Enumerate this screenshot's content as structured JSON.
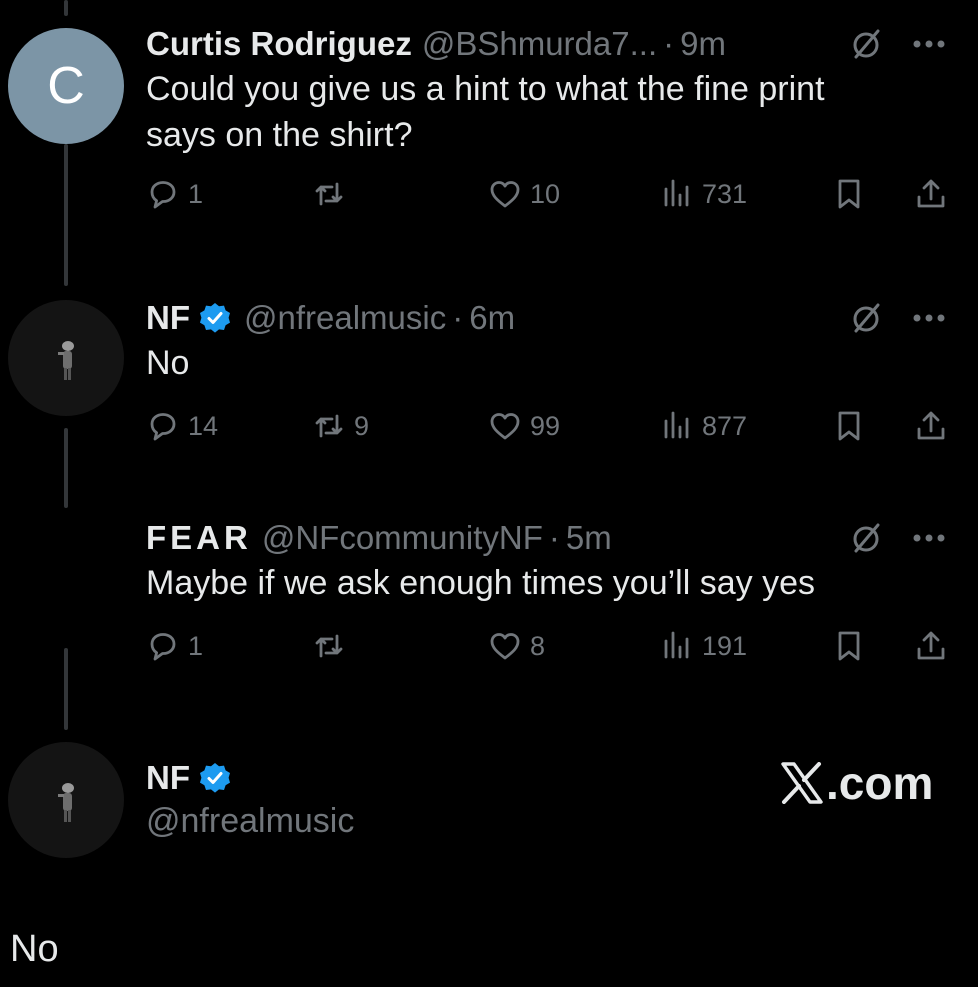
{
  "colors": {
    "background": "#000000",
    "text": "#e7e9ea",
    "muted": "#71767b",
    "verified_blue": "#1d9bf0",
    "avatar_letter_bg": "#7c95a6",
    "thread_line": "#333639"
  },
  "tweets": [
    {
      "avatar_letter": "C",
      "name": "Curtis Rodriguez",
      "verified": false,
      "handle": "@BShmurda7...",
      "separator": "·",
      "time": "9m",
      "text": "Could you give us a hint to what the fine print says on the shirt?",
      "replies": "1",
      "retweets": "",
      "likes": "10",
      "views": "731"
    },
    {
      "name": "NF",
      "verified": true,
      "handle": "@nfrealmusic",
      "separator": "·",
      "time": "6m",
      "text": "No",
      "replies": "14",
      "retweets": "9",
      "likes": "99",
      "views": "877"
    },
    {
      "name": "FEAR",
      "verified": false,
      "handle": "@NFcommunityNF",
      "separator": "·",
      "time": "5m",
      "text": "Maybe if we ask enough times you’ll say yes",
      "replies": "1",
      "retweets": "",
      "likes": "8",
      "views": "191"
    }
  ],
  "profile_card": {
    "name": "NF",
    "verified": true,
    "handle": "@nfrealmusic",
    "brand": ".com"
  },
  "footer_text": "No",
  "icons": {
    "reply": "reply-icon",
    "retweet": "retweet-icon",
    "like": "heart-icon",
    "views": "views-icon",
    "bookmark": "bookmark-icon",
    "share": "share-icon",
    "grok": "grok-icon",
    "more": "more-icon",
    "verified": "verified-badge-icon",
    "brand": "x-logo-icon"
  }
}
